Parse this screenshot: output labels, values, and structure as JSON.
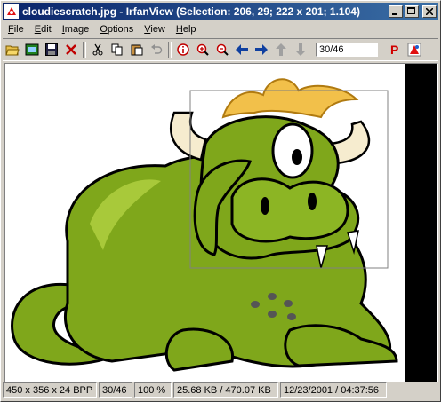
{
  "window": {
    "title": "cloudiescratch.jpg - IrfanView (Selection: 206, 29; 222 x 201; 1.104)"
  },
  "menu": [
    "File",
    "Edit",
    "Image",
    "Options",
    "View",
    "Help"
  ],
  "menu_underline": [
    "F",
    "E",
    "I",
    "O",
    "V",
    "H"
  ],
  "toolbar": {
    "page_field_value": "30/46"
  },
  "status": {
    "dimensions": "450 x 356 x 24 BPP",
    "page": "30/46",
    "zoom": "100 %",
    "filesize": "25.68 KB / 470.07 KB",
    "datetime": "12/23/2001 / 04:37:56"
  },
  "colors": {
    "title_active": "#0a246a",
    "dragon_green": "#7fa71b",
    "dragon_light": "#a8c93a",
    "hair": "#f2c04a",
    "horn": "#f6eccf"
  }
}
